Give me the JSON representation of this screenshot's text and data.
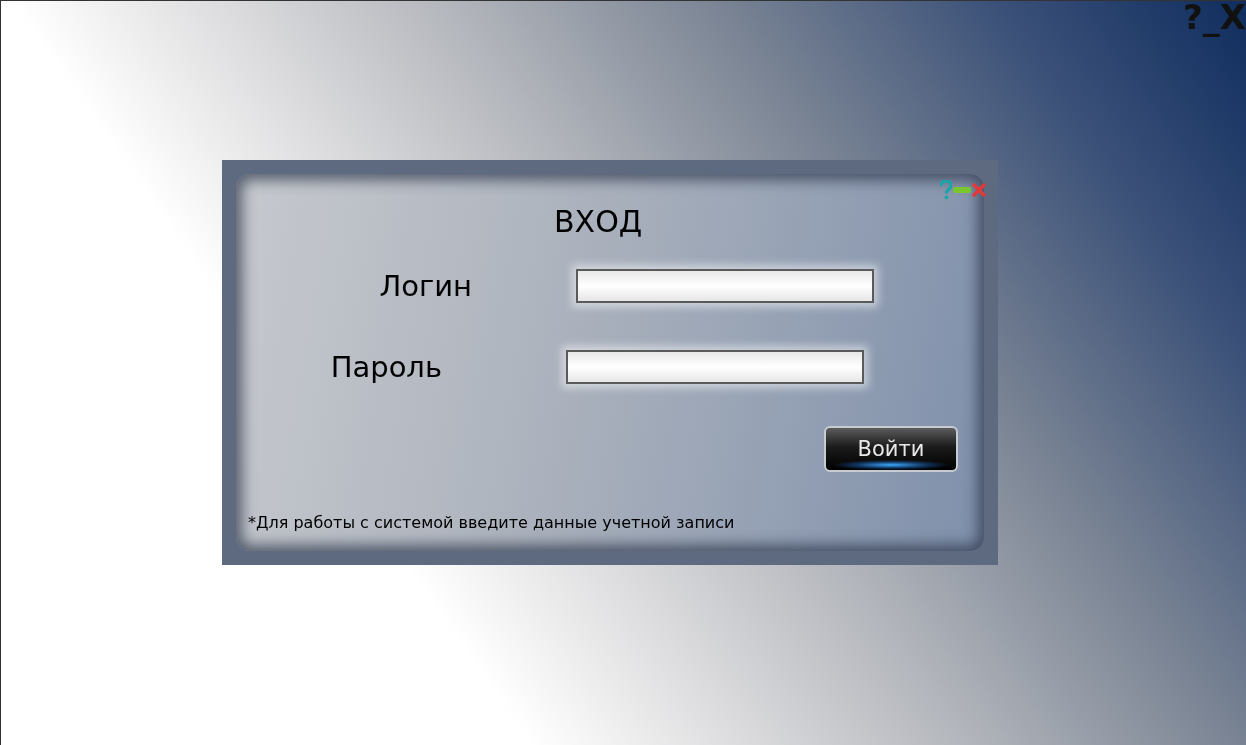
{
  "window": {
    "controls": [
      "?",
      "_",
      "X"
    ]
  },
  "dialog": {
    "title": "ВХОД",
    "fields": [
      {
        "label": "Логин"
      },
      {
        "label": "Пароль"
      }
    ],
    "button": "Войти",
    "note": "*Для работы с системой введите данные учетной записи"
  }
}
